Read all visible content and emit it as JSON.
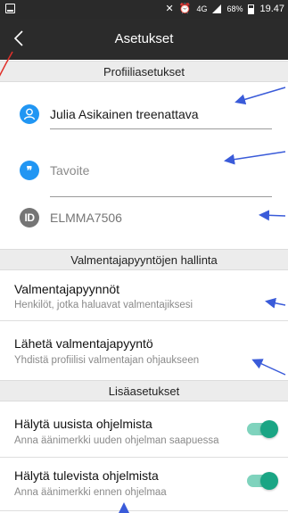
{
  "status_bar": {
    "network": "4G",
    "battery": "68%",
    "time": "19.47"
  },
  "app_bar": {
    "title": "Asetukset"
  },
  "sections": {
    "profile_header": "Profiiliasetukset",
    "coach_header": "Valmentajapyyntöjen hallinta",
    "more_header": "Lisäasetukset"
  },
  "profile": {
    "name": "Julia Asikainen treenattava",
    "goal_placeholder": "Tavoite",
    "id_code": "ELMMA7506"
  },
  "coach_requests": {
    "requests_title": "Valmentajapyynnöt",
    "requests_subtitle": "Henkilöt, jotka haluavat valmentajiksesi",
    "send_title": "Lähetä valmentajapyyntö",
    "send_subtitle": "Yhdistä profiilisi valmentajan ohjaukseen"
  },
  "more_settings": {
    "new_programs_title": "Hälytä uusista ohjelmista",
    "new_programs_subtitle": "Anna äänimerkki uuden ohjelman saapuessa",
    "upcoming_programs_title": "Hälytä tulevista ohjelmista",
    "upcoming_programs_subtitle": "Anna äänimerkki ennen ohjelmaa",
    "new_programs_enabled": true,
    "upcoming_programs_enabled": true
  },
  "icons": {
    "back": "chevron-left-icon",
    "user": "user-icon",
    "quote": "quote-icon",
    "id": "id-badge-icon"
  },
  "colors": {
    "accent_blue": "#2196f3",
    "toggle_on": "#1aa584",
    "annotation_arrow": "#3a5bd9",
    "app_bar": "#2b2b2b"
  }
}
